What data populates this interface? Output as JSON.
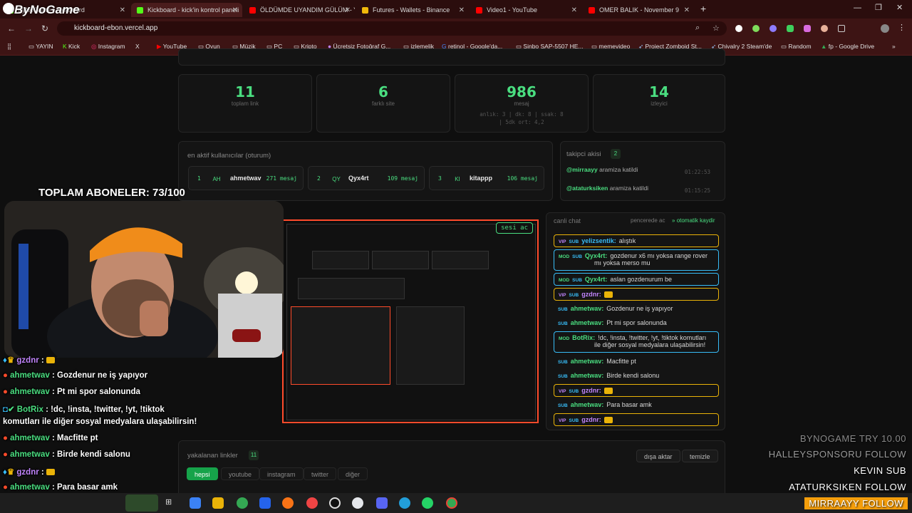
{
  "browser": {
    "tabs": [
      {
        "label": "ByNoGame | Kickboard",
        "fav": "#53fc18"
      },
      {
        "label": "Kickboard - kick'in kontrol paneli",
        "fav": "#53fc18"
      },
      {
        "label": "ÖLDÜMDE UYANDIM GÜLÜM - YouTube",
        "fav": "#ff0000"
      },
      {
        "label": "Futures - Wallets - Binance",
        "fav": "#f0b90b"
      },
      {
        "label": "Video1 - YouTube",
        "fav": "#ff0000"
      },
      {
        "label": "OMER BALIK - November 9",
        "fav": "#ff0000"
      }
    ],
    "url": "kickboard-ebon.vercel.app",
    "bookmarks": [
      "YAYIN",
      "Kick",
      "Instagram",
      "X",
      "YouTube",
      "Oyun",
      "Müzik",
      "PC",
      "Kripto",
      "Ücretsiz Fotoğraf G...",
      "izlemelik",
      "retinol - Google'da...",
      "Sinbo SAP-5507 HE...",
      "memevideo",
      "Project Zomboid St...",
      "Chivalry 2 Steam'de",
      "Random",
      "fp - Google Drive"
    ]
  },
  "stats": [
    {
      "value": "11",
      "label": "toplam link",
      "note": ""
    },
    {
      "value": "6",
      "label": "farklı site",
      "note": ""
    },
    {
      "value": "986",
      "label": "mesaj",
      "note": "anlık: 3 | dk: 8 | ssak: 8 | 5dk ort: 4,2"
    },
    {
      "value": "14",
      "label": "izleyici",
      "note": ""
    }
  ],
  "active_users": {
    "title": "en aktif kullanıcılar (oturum)",
    "users": [
      {
        "rank": "1",
        "abbr": "AH",
        "name": "ahmetwav",
        "count": "271 mesaj"
      },
      {
        "rank": "2",
        "abbr": "QY",
        "name": "Qyx4rt",
        "count": "109 mesaj"
      },
      {
        "rank": "3",
        "abbr": "KI",
        "name": "kitappp",
        "count": "106 mesaj"
      }
    ]
  },
  "follows": {
    "title": "takipci akisi",
    "count": "2",
    "items": [
      {
        "user": "@mirraayy",
        "text": "aramiza katildi",
        "time": "01:22:53"
      },
      {
        "user": "@ataturksiken",
        "text": "aramiza katildi",
        "time": "01:15:25"
      }
    ]
  },
  "embed": {
    "sound_button": "sesi ac"
  },
  "chat": {
    "title": "canli chat",
    "popout": "pencerede ac",
    "autoscroll": "otomatik kaydir",
    "messages": [
      {
        "kind": "vip",
        "badges": [
          "VIP",
          "SUB"
        ],
        "user": "yelizsentik:",
        "text": "alıştık",
        "color": "#38bdf8"
      },
      {
        "kind": "mod",
        "badges": [
          "MOD",
          "SUB"
        ],
        "user": "Qyx4rt:",
        "text": "gozdenur x6 mı yoksa range rover mı yoksa merso mu",
        "color": "#4ade80"
      },
      {
        "kind": "mod",
        "badges": [
          "MOD",
          "SUB"
        ],
        "user": "Qyx4rt:",
        "text": "aslan gozdenurum be",
        "color": "#4ade80"
      },
      {
        "kind": "vip",
        "badges": [
          "VIP",
          "SUB"
        ],
        "user": "gzdnr:",
        "text": "",
        "color": "#c084fc"
      },
      {
        "kind": "plain",
        "badges": [
          "SUB"
        ],
        "user": "ahmetwav:",
        "text": "Gozdenur ne iş yapıyor",
        "color": "#4ade80"
      },
      {
        "kind": "plain",
        "badges": [
          "SUB"
        ],
        "user": "ahmetwav:",
        "text": "Pt mi spor salonunda",
        "color": "#4ade80"
      },
      {
        "kind": "mod",
        "badges": [
          "MOD"
        ],
        "user": "BotRix:",
        "text": "!dc, !insta, !twitter, !yt, !tiktok komutları ile diğer sosyal medyalara ulaşabilirsin!",
        "color": "#4ade80"
      },
      {
        "kind": "plain",
        "badges": [
          "SUB"
        ],
        "user": "ahmetwav:",
        "text": "Macfitte pt",
        "color": "#4ade80"
      },
      {
        "kind": "plain",
        "badges": [
          "SUB"
        ],
        "user": "ahmetwav:",
        "text": "Birde kendi salonu",
        "color": "#4ade80"
      },
      {
        "kind": "vip",
        "badges": [
          "VIP",
          "SUB"
        ],
        "user": "gzdnr:",
        "text": "",
        "color": "#c084fc"
      },
      {
        "kind": "plain",
        "badges": [
          "SUB"
        ],
        "user": "ahmetwav:",
        "text": "Para basar amk",
        "color": "#4ade80"
      },
      {
        "kind": "vip",
        "badges": [
          "VIP",
          "SUB"
        ],
        "user": "gzdnr:",
        "text": "",
        "color": "#c084fc"
      }
    ]
  },
  "links": {
    "title": "yakalanan linkler",
    "count": "11",
    "clear": "temizle",
    "export": "dışa aktar",
    "filters": [
      "hepsi",
      "youtube",
      "instagram",
      "twitter",
      "diğer"
    ]
  },
  "overlay": {
    "logo": "ByNoGame",
    "subs_goal": "TOPLAM ABONELER: 73/100",
    "stream_chat": [
      {
        "user": "gzdnr",
        "text": ":"
      },
      {
        "user": "ahmetwav",
        "text": ": Gozdenur ne iş yapıyor"
      },
      {
        "user": "ahmetwav",
        "text": ": Pt mi spor salonunda"
      },
      {
        "user": "BotRix",
        "text": ": !dc, !insta, !twitter, !yt, !tiktok"
      },
      {
        "user": "",
        "text": "komutları ile diğer sosyal medyalara ulaşabilirsin!"
      },
      {
        "user": "ahmetwav",
        "text": ": Macfitte pt"
      },
      {
        "user": "ahmetwav",
        "text": ": Birde kendi salonu"
      },
      {
        "user": "gzdnr",
        "text": ":"
      },
      {
        "user": "ahmetwav",
        "text": ": Para basar amk"
      },
      {
        "user": "gzdnr",
        "text": ":"
      }
    ],
    "event_feed": [
      {
        "text": "BYNOGAME  TRY 10.00",
        "dim": true
      },
      {
        "text": "HALLEYSPONSORU  FOLLOW",
        "dim": true
      },
      {
        "text": "KEVIN  SUB",
        "dim": false
      },
      {
        "text": "ATATURKSIKEN  FOLLOW",
        "dim": false
      },
      {
        "text": "MIRRAAYY  FOLLOW",
        "dim": false
      }
    ]
  },
  "colors": {
    "accent": "#4ade80",
    "brand_red": "#ff4b2b",
    "vip": "#eab308",
    "mod": "#38bdf8"
  }
}
